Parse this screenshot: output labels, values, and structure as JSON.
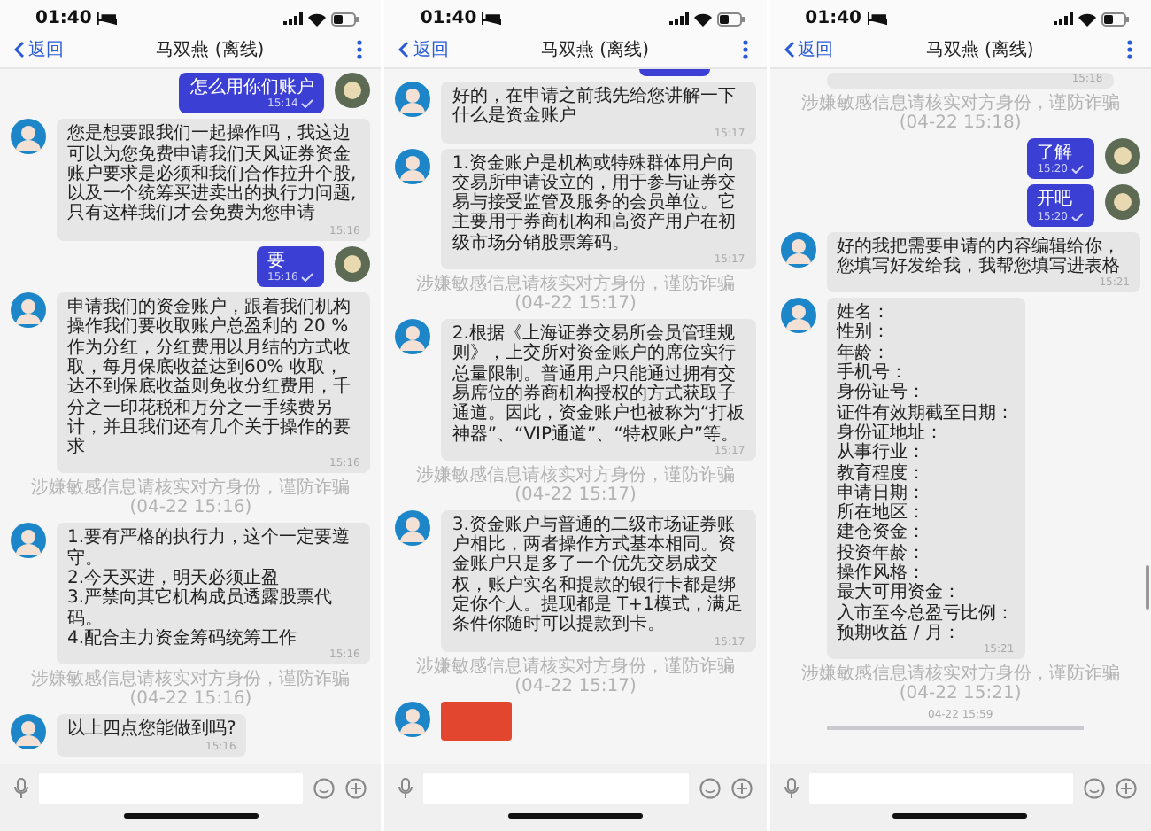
{
  "panels": [
    {
      "status_time": "01:40",
      "back": "返回",
      "title": "马双燕 (离线)",
      "messages": [
        {
          "kind": "sent",
          "text": "怎么用你们账户",
          "time": "15:14"
        },
        {
          "kind": "received",
          "text": "您是想要跟我们一起操作吗，我这边可以为您免费申请我们天风证券资金账户要求是必须和我们合作拉升个股,以及一个统筹买进卖出的执行力问题,只有这样我们才会免费为您申请",
          "time": "15:16"
        },
        {
          "kind": "sent",
          "text": "要",
          "time": "15:16"
        },
        {
          "kind": "received",
          "text": "申请我们的资金账户，跟着我们机构操作我们要收取账户总盈利的 20 % 作为分红，分红费用以月结的方式收取，每月保底收益达到60% 收取，达不到保底收益则免收分红费用，千分之一印花税和万分之一手续费另计，并且我们还有几个关于操作的要求",
          "time": "15:16"
        },
        {
          "kind": "notice",
          "text": "涉嫌敏感信息请核实对方身份，谨防诈骗 (04-22 15:16)"
        },
        {
          "kind": "received",
          "text": "1.要有严格的执行力，这个一定要遵守。\n2.今天买进，明天必须止盈\n3.严禁向其它机构成员透露股票代码。\n4.配合主力资金筹码统筹工作",
          "time": "15:16"
        },
        {
          "kind": "notice",
          "text": "涉嫌敏感信息请核实对方身份，谨防诈骗 (04-22 15:16)"
        },
        {
          "kind": "received",
          "text": "以上四点您能做到吗?",
          "time": "15:16"
        }
      ]
    },
    {
      "status_time": "01:40",
      "back": "返回",
      "title": "马双燕 (离线)",
      "messages": [
        {
          "kind": "partial-sent"
        },
        {
          "kind": "received",
          "text": "好的，在申请之前我先给您讲解一下什么是资金账户",
          "time": "15:17"
        },
        {
          "kind": "received",
          "text": "1.资金账户是机构或特殊群体用户向交易所申请设立的，用于参与证券交易与接受监管及服务的会员单位。它主要用于券商机构和高资产用户在初级市场分销股票筹码。",
          "time": "15:17"
        },
        {
          "kind": "notice",
          "text": "涉嫌敏感信息请核实对方身份，谨防诈骗 (04-22 15:17)"
        },
        {
          "kind": "received",
          "text": "2.根据《上海证券交易所会员管理规则》，上交所对资金账户的席位实行总量限制。普通用户只能通过拥有交易席位的券商机构授权的方式获取子通道。因此，资金账户也被称为“打板神器”、“VIP通道”、“特权账户”等。",
          "time": "15:17"
        },
        {
          "kind": "notice",
          "text": "涉嫌敏感信息请核实对方身份，谨防诈骗 (04-22 15:17)"
        },
        {
          "kind": "received",
          "text": "3.资金账户与普通的二级市场证券账户相比，两者操作方式基本相同。资金账户只是多了一个优先交易成交权，账户实名和提款的银行卡都是绑定你个人。提现都是 T+1模式，满足条件你随时可以提款到卡。",
          "time": "15:17"
        },
        {
          "kind": "notice",
          "text": "涉嫌敏感信息请核实对方身份，谨防诈骗 (04-22 15:17)"
        },
        {
          "kind": "image"
        }
      ]
    },
    {
      "status_time": "01:40",
      "back": "返回",
      "title": "马双燕 (离线)",
      "messages": [
        {
          "kind": "partial-received",
          "time": "15:18"
        },
        {
          "kind": "notice",
          "text": "涉嫌敏感信息请核实对方身份，谨防诈骗 (04-22 15:18)"
        },
        {
          "kind": "sent",
          "text": "了解",
          "time": "15:20"
        },
        {
          "kind": "sent",
          "text": "开吧",
          "time": "15:20"
        },
        {
          "kind": "received",
          "text": "好的我把需要申请的内容编辑给你，您填写好发给我，我帮您填写进表格",
          "time": "15:21"
        },
        {
          "kind": "form",
          "lines": [
            "姓名：",
            "性别：",
            "年龄：",
            "手机号：",
            "身份证号：",
            "证件有效期截至日期：",
            "身份证地址：",
            "从事行业：",
            "教育程度：",
            "申请日期：",
            "所在地区：",
            "建仓资金：",
            "投资年龄：",
            "操作风格：",
            "最大可用资金：",
            "入市至今总盈亏比例：",
            "预期收益 / 月："
          ],
          "time": "15:21"
        },
        {
          "kind": "notice",
          "text": "涉嫌敏感信息请核实对方身份，谨防诈骗 (04-22 15:21)"
        },
        {
          "kind": "date",
          "text": "04-22 15:59"
        },
        {
          "kind": "cut-received"
        }
      ]
    }
  ]
}
